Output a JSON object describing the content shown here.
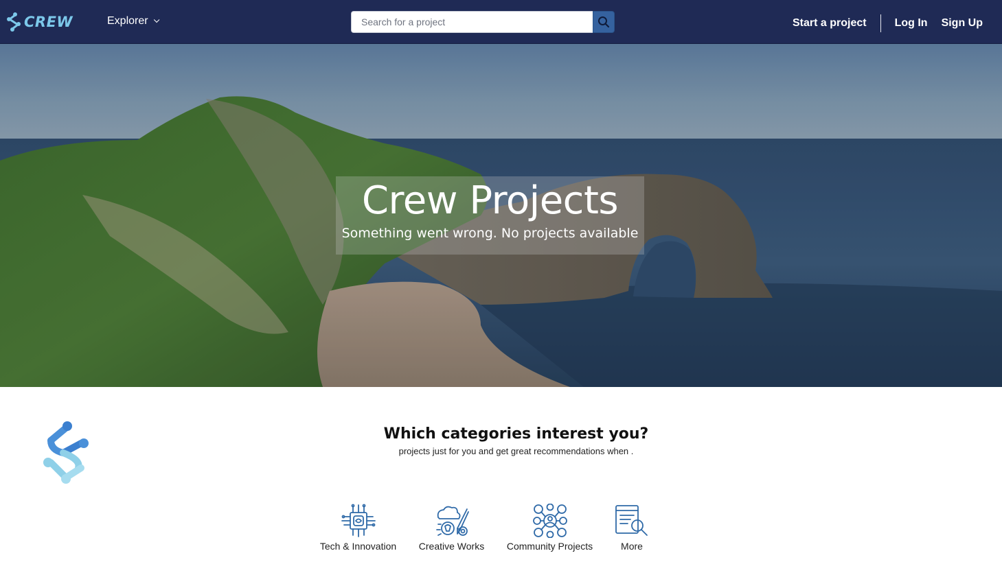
{
  "header": {
    "brand": "CREW",
    "explorer_label": "Explorer",
    "search_placeholder": "Search for a project",
    "start_project": "Start a project",
    "log_in": "Log In",
    "sign_up": "Sign Up"
  },
  "hero": {
    "title": "Crew Projects",
    "subtitle": "Something went wrong. No projects available"
  },
  "categories": {
    "heading": "Which categories interest you?",
    "subheading": "projects just for you and get great recommendations when .",
    "items": [
      {
        "label": "Tech & Innovation",
        "icon": "chip-icon"
      },
      {
        "label": "Creative Works",
        "icon": "creative-icon"
      },
      {
        "label": "Community Projects",
        "icon": "community-icon"
      },
      {
        "label": "More",
        "icon": "document-search-icon"
      }
    ]
  },
  "colors": {
    "navbar": "#1f2a55",
    "accent": "#35629f",
    "logo_blue": "#4a90d9",
    "logo_light": "#8fd0e8",
    "icon_blue": "#2f6aa8"
  }
}
